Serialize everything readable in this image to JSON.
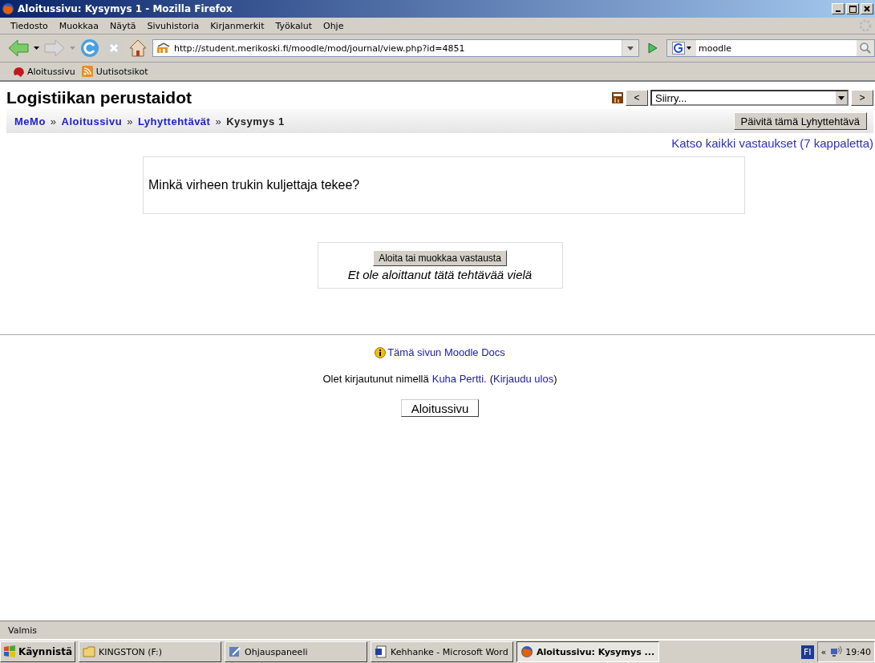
{
  "window": {
    "title": "Aloitussivu: Kysymys 1 - Mozilla Firefox"
  },
  "menu": [
    "Tiedosto",
    "Muokkaa",
    "Näytä",
    "Sivuhistoria",
    "Kirjanmerkit",
    "Työkalut",
    "Ohje"
  ],
  "toolbar": {
    "url": "http://student.merikoski.fi/moodle/mod/journal/view.php?id=4851",
    "search": "moodle"
  },
  "bookmarks": [
    {
      "label": "Aloitussivu",
      "kind": "home"
    },
    {
      "label": "Uutisotsikot",
      "kind": "feed"
    }
  ],
  "page": {
    "course_title": "Logistiikan perustaidot",
    "jump_select": "Siirry...",
    "prev_button": "<",
    "next_button": ">",
    "breadcrumb": [
      {
        "label": "MeMo",
        "link": true
      },
      {
        "separator": "»",
        "label": "Aloitussivu",
        "link": true
      },
      {
        "separator": "»",
        "label": "Lyhyttehtävät",
        "link": true
      },
      {
        "separator": "»",
        "label": "Kysymys 1",
        "link": false
      }
    ],
    "update_button": "Päivitä tämä Lyhyttehtävä",
    "view_all_link": "Katso kaikki vastaukset (7 kappaletta)",
    "question": "Minkä virheen trukin kuljettaja tekee?",
    "start_button": "Aloita tai muokkaa vastausta",
    "notice": "Et ole aloittanut tätä tehtävää vielä",
    "docs_link": "Tämä sivun Moodle Docs",
    "login_text": "Olet kirjautunut nimellä",
    "user_link": "Kuha Pertti.",
    "logout_open": "(",
    "logout_link": "Kirjaudu ulos",
    "logout_close": ")",
    "home_button": "Aloitussivu"
  },
  "status_bar": "Valmis",
  "taskbar": {
    "start": "Käynnistä",
    "tasks": [
      {
        "label": "KINGSTON (F:)",
        "kind": "folder",
        "selected": false
      },
      {
        "label": "Ohjauspaneeli",
        "kind": "panel",
        "selected": false
      },
      {
        "label": "Kehhanke - Microsoft Word",
        "kind": "word",
        "selected": false
      },
      {
        "label": "Aloitussivu: Kysymys ...",
        "kind": "browser",
        "selected": true
      }
    ],
    "language": "FI",
    "chevron": "«",
    "clock": "19:40"
  }
}
